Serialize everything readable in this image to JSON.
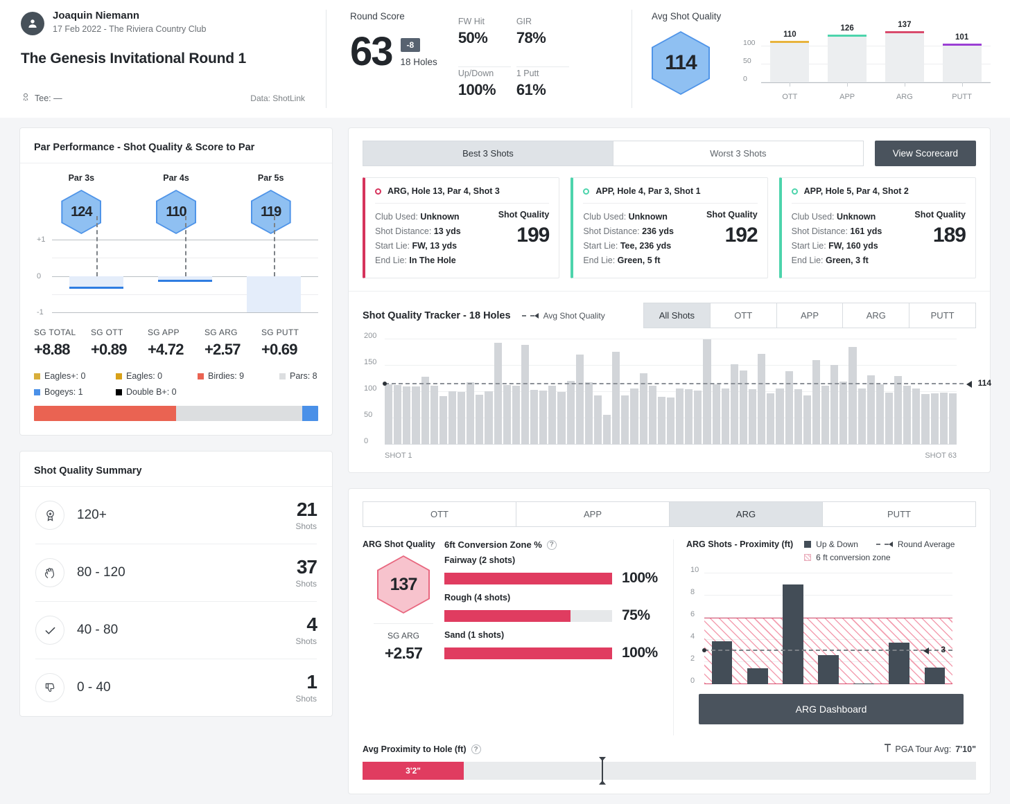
{
  "header": {
    "player_name": "Joaquin Niemann",
    "player_sub": "17 Feb 2022 - The Riviera Country Club",
    "round_title": "The Genesis Invitational Round 1",
    "tee_label": "Tee: —",
    "data_source": "Data: ShotLink",
    "round_score": {
      "label": "Round Score",
      "score": "63",
      "to_par": "-8",
      "holes": "18 Holes"
    },
    "percentages": [
      {
        "label": "FW Hit",
        "value": "50%"
      },
      {
        "label": "GIR",
        "value": "78%"
      },
      {
        "label": "Up/Down",
        "value": "100%"
      },
      {
        "label": "1 Putt",
        "value": "61%"
      }
    ],
    "avg_shot_quality": {
      "label": "Avg Shot Quality",
      "value": "114"
    }
  },
  "chart_data": [
    {
      "type": "bar",
      "title": "Avg Shot Quality by category",
      "categories": [
        "OTT",
        "APP",
        "ARG",
        "PUTT"
      ],
      "values": [
        110,
        126,
        137,
        101
      ],
      "colors": [
        "#e8b33c",
        "#4dd4ac",
        "#d94a6c",
        "#9b3fd4"
      ],
      "yticks": [
        "100",
        "50",
        "0"
      ],
      "ylim": [
        0,
        150
      ]
    },
    {
      "type": "bar",
      "title": "Par Performance - Shot Quality & Score to Par",
      "categories": [
        "Par 3s",
        "Par 4s",
        "Par 5s"
      ],
      "shot_quality": [
        124,
        110,
        119
      ],
      "score_to_par": [
        -0.33,
        -0.15,
        -1.0
      ],
      "yticks": [
        "+1",
        "0",
        "-1"
      ],
      "ylim": [
        -1,
        1
      ]
    },
    {
      "type": "bar",
      "title": "Shot Quality Tracker - 18 Holes",
      "xlabel_start": "SHOT 1",
      "xlabel_end": "SHOT 63",
      "yticks": [
        "200",
        "150",
        "100",
        "50",
        "0"
      ],
      "ylim": [
        0,
        200
      ],
      "avg_line": 114,
      "values": [
        114,
        113,
        111,
        110,
        129,
        112,
        92,
        101,
        100,
        118,
        95,
        101,
        193,
        113,
        112,
        190,
        104,
        103,
        112,
        100,
        121,
        171,
        118,
        94,
        57,
        176,
        93,
        106,
        135,
        112,
        91,
        90,
        107,
        105,
        103,
        200,
        114,
        106,
        152,
        141,
        105,
        172,
        98,
        107,
        139,
        105,
        94,
        160,
        112,
        151,
        120,
        186,
        106,
        132,
        114,
        99,
        130,
        112,
        106,
        96,
        97,
        99,
        98
      ]
    },
    {
      "type": "bar",
      "title": "ARG Shots - Proximity (ft)",
      "yticks": [
        "10",
        "8",
        "6",
        "4",
        "2",
        "0"
      ],
      "ylim": [
        0,
        10
      ],
      "values": [
        3.9,
        1.45,
        9.0,
        2.65,
        0.05,
        3.75,
        1.5
      ],
      "avg_line": 3,
      "avg_label": "3",
      "zone_max": 6
    }
  ],
  "par_performance": {
    "title": "Par Performance - Shot Quality & Score to Par",
    "columns": [
      {
        "label": "Par 3s",
        "quality": "124"
      },
      {
        "label": "Par 4s",
        "quality": "110"
      },
      {
        "label": "Par 5s",
        "quality": "119"
      }
    ],
    "y_labels": [
      "+1",
      "0",
      "-1"
    ],
    "sg": [
      {
        "label": "SG TOTAL",
        "value": "+8.88"
      },
      {
        "label": "SG OTT",
        "value": "+0.89"
      },
      {
        "label": "SG APP",
        "value": "+4.72"
      },
      {
        "label": "SG ARG",
        "value": "+2.57"
      },
      {
        "label": "SG PUTT",
        "value": "+0.69"
      }
    ],
    "legend": [
      {
        "label": "Eagles+: 0",
        "color": "#d8ae3a",
        "count": 0
      },
      {
        "label": "Eagles: 0",
        "color": "#d8a119",
        "count": 0
      },
      {
        "label": "Birdies: 9",
        "color": "#ea6352",
        "count": 9
      },
      {
        "label": "Pars: 8",
        "color": "#dcdee0",
        "count": 8
      },
      {
        "label": "Bogeys: 1",
        "color": "#4a90e8",
        "count": 1
      },
      {
        "label": "Double B+: 0",
        "color": "#000000",
        "count": 0
      }
    ]
  },
  "best_shots": {
    "tabs": [
      {
        "label": "Best 3 Shots",
        "active": true
      },
      {
        "label": "Worst 3 Shots",
        "active": false
      }
    ],
    "view_scorecard": "View Scorecard",
    "quality_label": "Shot Quality",
    "cards": [
      {
        "heading": "ARG, Hole 13, Par 4, Shot 3",
        "accent": "#d6335c",
        "club_label": "Club Used:",
        "club": "Unknown",
        "distance_label": "Shot Distance:",
        "distance": "13 yds",
        "start_label": "Start Lie:",
        "start": "FW, 13 yds",
        "end_label": "End Lie:",
        "end": "In The Hole",
        "quality": "199"
      },
      {
        "heading": "APP, Hole 4, Par 3, Shot 1",
        "accent": "#4dd4ac",
        "club_label": "Club Used:",
        "club": "Unknown",
        "distance_label": "Shot Distance:",
        "distance": "236 yds",
        "start_label": "Start Lie:",
        "start": "Tee, 236 yds",
        "end_label": "End Lie:",
        "end": "Green, 5 ft",
        "quality": "192"
      },
      {
        "heading": "APP, Hole 5, Par 4, Shot 2",
        "accent": "#4dd4ac",
        "club_label": "Club Used:",
        "club": "Unknown",
        "distance_label": "Shot Distance:",
        "distance": "161 yds",
        "start_label": "Start Lie:",
        "start": "FW, 160 yds",
        "end_label": "End Lie:",
        "end": "Green, 3 ft",
        "quality": "189"
      }
    ]
  },
  "tracker": {
    "title": "Shot Quality Tracker - 18 Holes",
    "avg_key": "Avg Shot Quality",
    "avg_value": "114",
    "tabs": [
      {
        "label": "All Shots",
        "active": true
      },
      {
        "label": "OTT",
        "active": false
      },
      {
        "label": "APP",
        "active": false
      },
      {
        "label": "ARG",
        "active": false
      },
      {
        "label": "PUTT",
        "active": false
      }
    ],
    "x_start": "SHOT 1",
    "x_end": "SHOT 63",
    "y_labels": [
      "200",
      "150",
      "100",
      "50",
      "0"
    ]
  },
  "summary": {
    "title": "Shot Quality Summary",
    "rows": [
      {
        "icon": "medal-icon",
        "range": "120+",
        "count": "21",
        "unit": "Shots"
      },
      {
        "icon": "clap-icon",
        "range": "80 - 120",
        "count": "37",
        "unit": "Shots"
      },
      {
        "icon": "check-icon",
        "range": "40 - 80",
        "count": "4",
        "unit": "Shots"
      },
      {
        "icon": "thumbs-down-icon",
        "range": "0 - 40",
        "count": "1",
        "unit": "Shots"
      }
    ]
  },
  "arg_panel": {
    "tabs": [
      {
        "label": "OTT",
        "active": false
      },
      {
        "label": "APP",
        "active": false
      },
      {
        "label": "ARG",
        "active": true
      },
      {
        "label": "PUTT",
        "active": false
      }
    ],
    "shot_quality_label": "ARG Shot Quality",
    "shot_quality_value": "137",
    "sg_label": "SG ARG",
    "sg_value": "+2.57",
    "conversion_title": "6ft Conversion Zone %",
    "conversion": [
      {
        "name": "Fairway (2 shots)",
        "pct": "100%",
        "value": 100
      },
      {
        "name": "Rough (4 shots)",
        "pct": "75%",
        "value": 75
      },
      {
        "name": "Sand (1 shots)",
        "pct": "100%",
        "value": 100
      }
    ],
    "proximity_title": "ARG Shots - Proximity (ft)",
    "keys": [
      {
        "label": "Up & Down",
        "type": "solid"
      },
      {
        "label": "Round Average",
        "type": "dashed"
      },
      {
        "label": "6 ft conversion zone",
        "type": "hatch"
      }
    ],
    "prox_y_labels": [
      "10",
      "8",
      "6",
      "4",
      "2",
      "0"
    ],
    "round_avg_label": "3",
    "dashboard_button": "ARG Dashboard",
    "avg_prox_title": "Avg Proximity to Hole (ft)",
    "avg_prox_value": "3'2\"",
    "tour_avg_label": "PGA Tour Avg:",
    "tour_avg_value": "7'10\""
  }
}
